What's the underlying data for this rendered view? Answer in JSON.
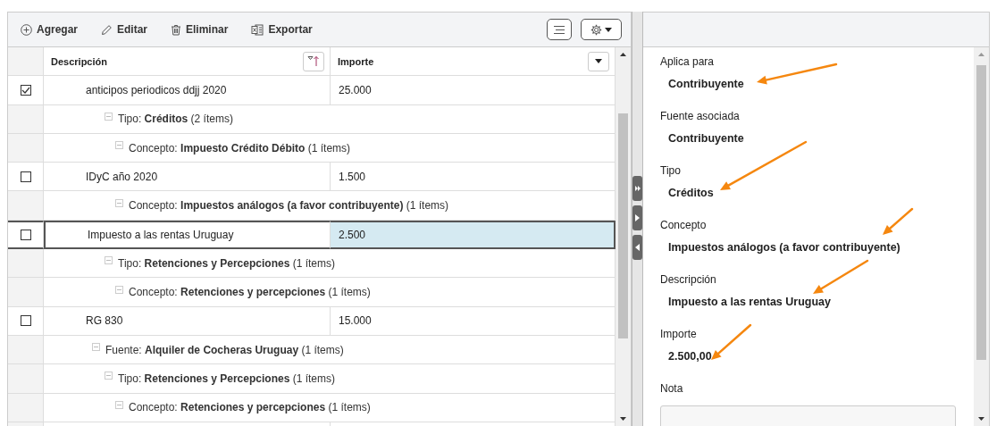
{
  "toolbar": {
    "buttons": [
      {
        "kind": "add",
        "label": "Agregar"
      },
      {
        "kind": "edit",
        "label": "Editar"
      },
      {
        "kind": "delete",
        "label": "Eliminar"
      },
      {
        "kind": "export",
        "label": "Exportar"
      }
    ]
  },
  "table": {
    "columns": [
      "Descripción",
      "Importe"
    ],
    "rows": [
      {
        "kind": "item",
        "description": "anticipos periodicos ddjj 2020",
        "amount": "25.000",
        "checked": true,
        "selected": false
      },
      {
        "kind": "tipo",
        "text": "Tipo: **Créditos** (2 ítems)",
        "expanded": true,
        "children": [
          {
            "kind": "concepto",
            "text": "Concepto: **Impuesto Crédito Débito** (1 ítems)",
            "expanded": true,
            "children": [
              {
                "kind": "item",
                "description": "IDyC año 2020",
                "amount": "1.500",
                "checked": false,
                "selected": false
              }
            ]
          },
          {
            "kind": "concepto",
            "text": "Concepto: **Impuestos análogos (a favor contribuyente)** (1 ítems)",
            "expanded": true,
            "children": [
              {
                "kind": "item",
                "description": "Impuesto a las rentas Uruguay",
                "amount": "2.500",
                "checked": false,
                "selected": true
              }
            ]
          }
        ]
      },
      {
        "kind": "tipo",
        "text": "Tipo: **Retenciones y Percepciones** (1 ítems)",
        "expanded": true,
        "children": [
          {
            "kind": "concepto",
            "text": "Concepto: **Retenciones y percepciones** (1 ítems)",
            "expanded": true,
            "children": [
              {
                "kind": "item",
                "description": "RG 830",
                "amount": "15.000",
                "checked": false,
                "selected": false
              }
            ]
          }
        ]
      },
      {
        "kind": "fuente",
        "text": "Fuente: **Alquiler de Cocheras Uruguay** (1 ítems)",
        "expanded": true,
        "children": [
          {
            "kind": "tipo",
            "text": "Tipo: **Retenciones y Percepciones** (1 ítems)",
            "expanded": true,
            "children": [
              {
                "kind": "concepto",
                "text": "Concepto: **Retenciones y percepciones** (1 ítems)",
                "expanded": true
              }
            ]
          }
        ]
      }
    ]
  },
  "details": {
    "fields": [
      {
        "kind": "text",
        "label": "Aplica para",
        "value": "Contribuyente"
      },
      {
        "kind": "text",
        "label": "Fuente asociada",
        "value": "Contribuyente"
      },
      {
        "kind": "text",
        "label": "Tipo",
        "value": "Créditos"
      },
      {
        "kind": "text",
        "label": "Concepto",
        "value": "Impuestos análogos (a favor contribuyente)"
      },
      {
        "kind": "text",
        "label": "Descripción",
        "value": "Impuesto a las rentas Uruguay"
      },
      {
        "kind": "text",
        "label": "Importe",
        "value": "2.500,00"
      },
      {
        "kind": "note",
        "label": "Nota"
      }
    ]
  }
}
